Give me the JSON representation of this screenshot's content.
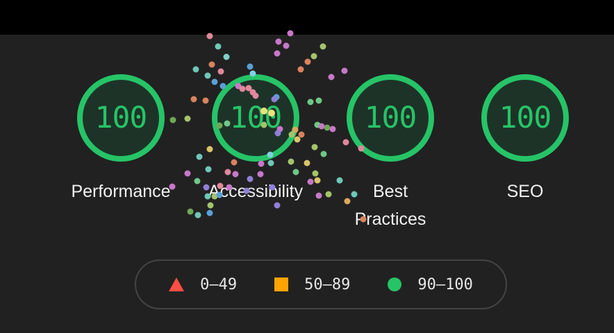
{
  "colors": {
    "background": "#212121",
    "pass": "#26c467",
    "average": "#ffa400",
    "fail": "#ff4e42"
  },
  "gauges": [
    {
      "label": "Performance",
      "score": "100",
      "fraction": 1.0
    },
    {
      "label": "Accessibility",
      "score": "100",
      "fraction": 1.0
    },
    {
      "label": "Best Practices",
      "score": "100",
      "fraction": 1.0
    },
    {
      "label": "SEO",
      "score": "100",
      "fraction": 1.0
    }
  ],
  "legend": [
    {
      "shape": "triangle-icon",
      "range": "0–49"
    },
    {
      "shape": "square-icon",
      "range": "50–89"
    },
    {
      "shape": "circle-icon",
      "range": "90–100"
    }
  ]
}
